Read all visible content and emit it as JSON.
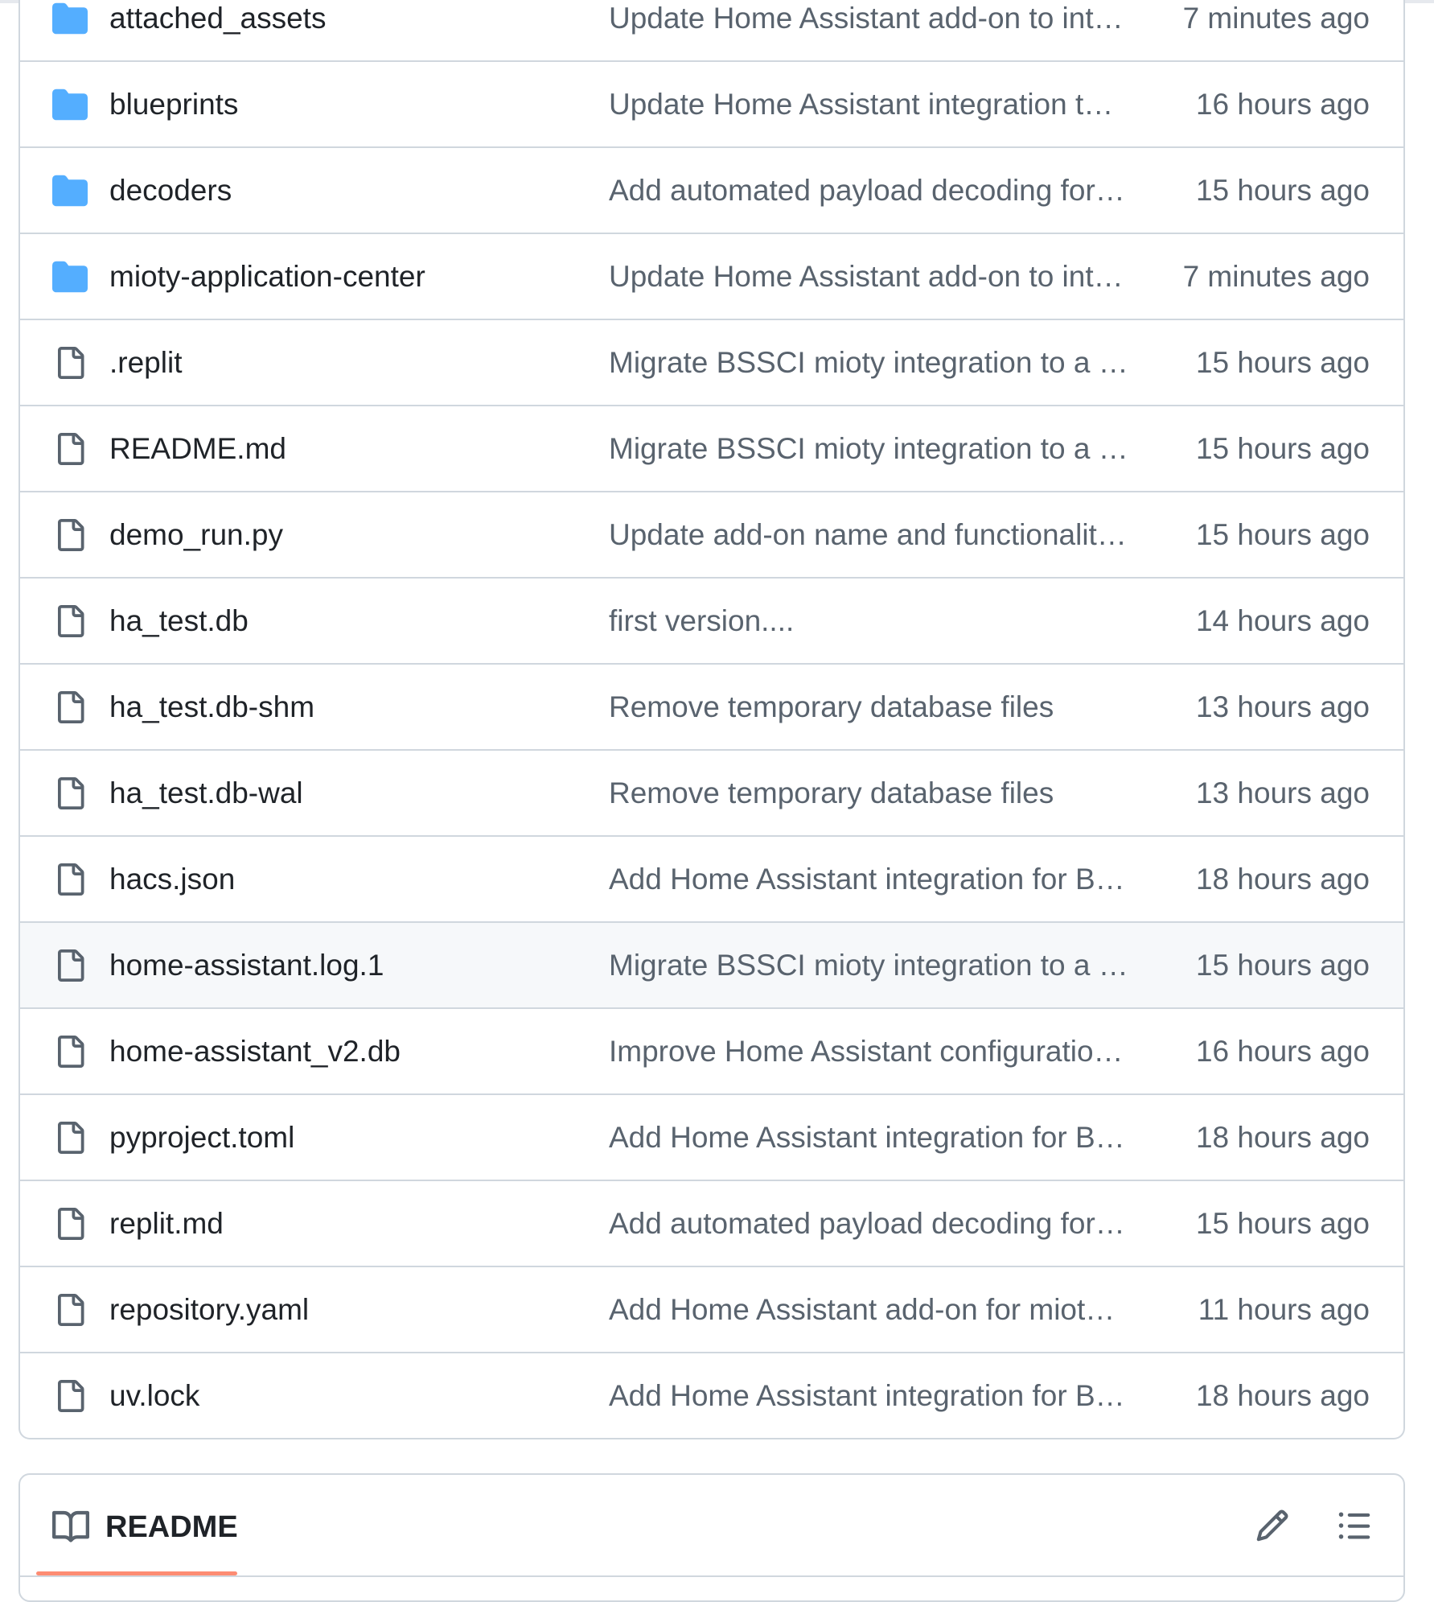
{
  "colors": {
    "folder": "#54aeff",
    "file_icon": "#59636e",
    "border": "#d0d7de",
    "muted_text": "#59636e",
    "hover_row": "#f6f8fa",
    "tab_underline": "#fd8c73"
  },
  "files": [
    {
      "name": "attached_assets",
      "type": "folder",
      "icon": "folder-icon",
      "message": "Update Home Assistant add-on to int…",
      "time": "7 minutes ago"
    },
    {
      "name": "blueprints",
      "type": "folder",
      "icon": "folder-icon",
      "message": "Update Home Assistant integration t…",
      "time": "16 hours ago"
    },
    {
      "name": "decoders",
      "type": "folder",
      "icon": "folder-icon",
      "message": "Add automated payload decoding for…",
      "time": "15 hours ago"
    },
    {
      "name": "mioty-application-center",
      "type": "folder",
      "icon": "folder-icon",
      "message": "Update Home Assistant add-on to int…",
      "time": "7 minutes ago"
    },
    {
      "name": ".replit",
      "type": "file",
      "icon": "file-icon",
      "message": "Migrate BSSCI mioty integration to a …",
      "time": "15 hours ago"
    },
    {
      "name": "README.md",
      "type": "file",
      "icon": "file-icon",
      "message": "Migrate BSSCI mioty integration to a …",
      "time": "15 hours ago"
    },
    {
      "name": "demo_run.py",
      "type": "file",
      "icon": "file-icon",
      "message": "Update add-on name and functionalit…",
      "time": "15 hours ago"
    },
    {
      "name": "ha_test.db",
      "type": "file",
      "icon": "file-icon",
      "message": "first version....",
      "time": "14 hours ago"
    },
    {
      "name": "ha_test.db-shm",
      "type": "file",
      "icon": "file-icon",
      "message": "Remove temporary database files",
      "time": "13 hours ago"
    },
    {
      "name": "ha_test.db-wal",
      "type": "file",
      "icon": "file-icon",
      "message": "Remove temporary database files",
      "time": "13 hours ago"
    },
    {
      "name": "hacs.json",
      "type": "file",
      "icon": "file-icon",
      "message": "Add Home Assistant integration for B…",
      "time": "18 hours ago"
    },
    {
      "name": "home-assistant.log.1",
      "type": "file",
      "icon": "file-icon",
      "message": "Migrate BSSCI mioty integration to a …",
      "time": "15 hours ago",
      "hovered": true
    },
    {
      "name": "home-assistant_v2.db",
      "type": "file",
      "icon": "file-icon",
      "message": "Improve Home Assistant configuratio…",
      "time": "16 hours ago"
    },
    {
      "name": "pyproject.toml",
      "type": "file",
      "icon": "file-icon",
      "message": "Add Home Assistant integration for B…",
      "time": "18 hours ago"
    },
    {
      "name": "replit.md",
      "type": "file",
      "icon": "file-icon",
      "message": "Add automated payload decoding for…",
      "time": "15 hours ago"
    },
    {
      "name": "repository.yaml",
      "type": "file",
      "icon": "file-icon",
      "message": "Add Home Assistant add-on for miot…",
      "time": "11 hours ago"
    },
    {
      "name": "uv.lock",
      "type": "file",
      "icon": "file-icon",
      "message": "Add Home Assistant integration for B…",
      "time": "18 hours ago"
    }
  ],
  "readme": {
    "title": "README",
    "icon": "book-icon",
    "edit_icon": "pencil-icon",
    "outline_icon": "list-icon"
  }
}
